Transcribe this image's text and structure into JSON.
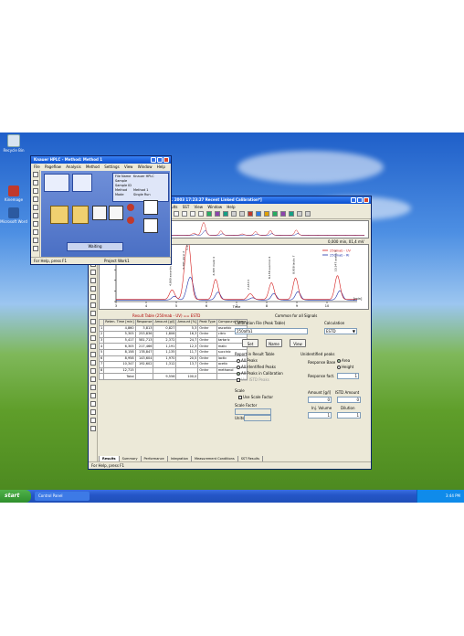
{
  "desktop": {
    "icons": [
      "Recycle Bin",
      "Kinemage",
      "Microsoft Word"
    ]
  },
  "hplc_small": {
    "title": "Knauer HPLC - Method: Method 1",
    "menu": [
      "File",
      "Pageflow",
      "Analysis",
      "Method",
      "Settings",
      "View",
      "Window",
      "Help"
    ],
    "info": {
      "file_name_label": "File Name",
      "file_name_value": "Knauer HPLC",
      "sample_label": "Sample",
      "sample_id_label": "Sample ID",
      "method_label": "Method",
      "method_value": "Method 1",
      "mode_label": "Mode",
      "mode_value": "Single Run"
    },
    "flow_label": "Waiting",
    "status_left": "For Help, press F1",
    "status_right": "Project Work1"
  },
  "main_window": {
    "title": "- UV *1.8. 2003 17:23:27 Recent Linked Calibration*]",
    "menu": [
      "Results",
      "SST",
      "View",
      "Window",
      "Help"
    ],
    "overview_readout": "0,000 min, 01,4 mV",
    "chart": {
      "x_label": "Time",
      "x_unit": "[min]",
      "y_unit": "[mV]",
      "legend": [
        "250mab - UV",
        "250mab - RI"
      ],
      "peak_labels": [
        "4,860 ascorbic 1",
        "5,305 citric 2",
        "5,417 tartaric 3",
        "6,305 malic 4",
        "7,453 5",
        "8,158 succinic 6",
        "8,958 lactic 7",
        "10,347 acetic 8"
      ]
    },
    "result_table": {
      "caption": "Result Table (250mab - UV) == ESTD",
      "headers": [
        "",
        "Reten. Time [min]",
        "Response",
        "Amount [g/l]",
        "Amount [%]",
        "Peak Type",
        "Compound Name"
      ],
      "rows": [
        [
          "1",
          "4,860",
          "3,813",
          "0,827",
          "5,3",
          "Ordnr",
          "ascorbic"
        ],
        [
          "2",
          "5,305",
          "253,836",
          "1,806",
          "16,3",
          "Ordnr",
          "citric"
        ],
        [
          "3",
          "5,417",
          "581,713",
          "2,372",
          "24,7",
          "Ordnr",
          "tartaric"
        ],
        [
          "4",
          "6,305",
          "217,466",
          "1,191",
          "12,3",
          "Ordnr",
          "malic"
        ],
        [
          "5",
          "8,158",
          "178,847",
          "1,135",
          "11,7",
          "Ordnr",
          "succinic"
        ],
        [
          "6",
          "8,958",
          "143,604",
          "1,970",
          "20,5",
          "Ordnr",
          "lactic"
        ],
        [
          "7",
          "10,347",
          "192,602",
          "1,312",
          "13,7",
          "Ordnr",
          "acetic"
        ],
        [
          "8",
          "12,715",
          "",
          "",
          "",
          "Ordnr",
          "methanol"
        ],
        [
          "",
          "Total",
          "",
          "9,556",
          "100,0",
          "",
          ""
        ]
      ]
    },
    "side_panel": {
      "header": "Common for all Signals",
      "calib_file_label": "Calibration File (Peak Table)",
      "calib_file_value": "250alfa1",
      "calculation_label": "Calculation",
      "calculation_value": "ESTD",
      "btn_set": "Set",
      "btn_name": "Name",
      "btn_view": "View",
      "report_label": "Report in Result Table",
      "report_options": [
        "All Peaks",
        "All Identified Peaks",
        "All Peaks in Calibration",
        "Use ISTD Peaks"
      ],
      "unidentified_label": "Unidentified peaks",
      "response_base_label": "Response Base",
      "response_options": [
        "Area",
        "Height"
      ],
      "response_fact_label": "Response fact.",
      "response_fact_value": "1",
      "scale_label": "Scale",
      "use_scale_label": "Use Scale Factor",
      "scale_factor_label": "Scale Factor",
      "units_label": "Units",
      "amount_label": "Amount [g/l]",
      "istd_amount_label": "ISTD Amount",
      "amount_value": "0",
      "istd_value": "0",
      "inj_volume_label": "Inj. Volume",
      "dilution_label": "Dilution",
      "inj_volume_value": "1",
      "dilution_value": "1"
    },
    "tabs": [
      "Results",
      "Summary",
      "Performance",
      "Integration",
      "Measurement Conditions",
      "SST Results"
    ],
    "status_left": "For Help, press F1"
  },
  "taskbar": {
    "start_label": "start",
    "task_label": "Control Panel",
    "clock": "3:44 PM"
  },
  "colors": {
    "uv_trace": "#d41c1c",
    "ri_trace": "#1a2ea8"
  }
}
